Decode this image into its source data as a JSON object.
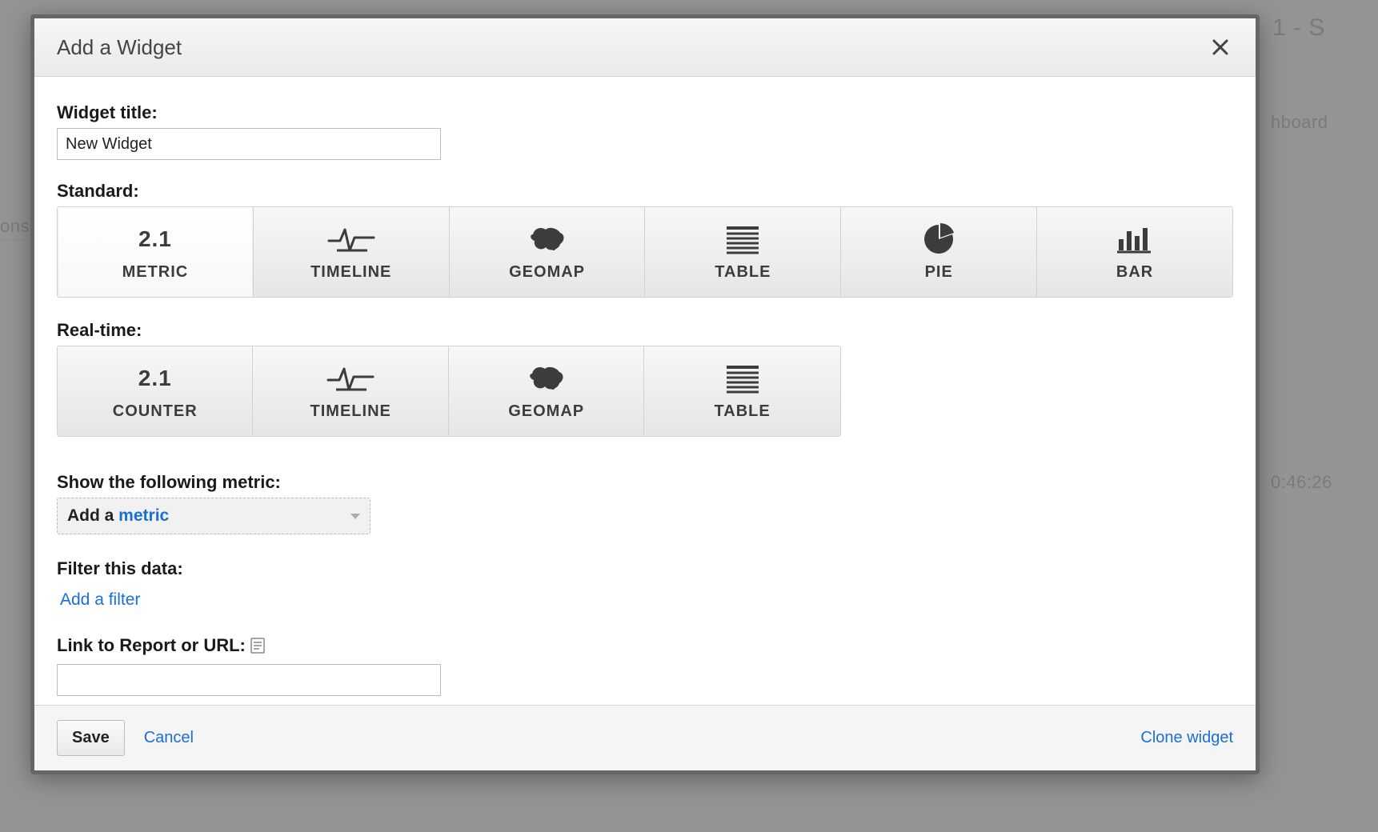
{
  "background": {
    "top_right_text": "1 - S",
    "right_text_1": "hboard",
    "right_text_2": "0:46:26",
    "left_text": "ons"
  },
  "modal": {
    "title": "Add a Widget",
    "widget_title_label": "Widget title:",
    "widget_title_value": "New Widget",
    "standard_label": "Standard:",
    "standard_tiles": [
      {
        "key": "metric",
        "label": "METRIC",
        "icon_text": "2.1"
      },
      {
        "key": "timeline",
        "label": "TIMELINE"
      },
      {
        "key": "geomap",
        "label": "GEOMAP"
      },
      {
        "key": "table",
        "label": "TABLE"
      },
      {
        "key": "pie",
        "label": "PIE"
      },
      {
        "key": "bar",
        "label": "BAR"
      }
    ],
    "realtime_label": "Real-time:",
    "realtime_tiles": [
      {
        "key": "counter",
        "label": "COUNTER",
        "icon_text": "2.1"
      },
      {
        "key": "timeline",
        "label": "TIMELINE"
      },
      {
        "key": "geomap",
        "label": "GEOMAP"
      },
      {
        "key": "table",
        "label": "TABLE"
      }
    ],
    "metric_section_label": "Show the following metric:",
    "add_metric_prefix": "Add a ",
    "add_metric_link": "metric",
    "filter_label": "Filter this data:",
    "add_filter_link": "Add a filter",
    "link_label": "Link to Report or URL:",
    "link_value": "",
    "footer": {
      "save_label": "Save",
      "cancel_label": "Cancel",
      "clone_label": "Clone widget"
    }
  }
}
